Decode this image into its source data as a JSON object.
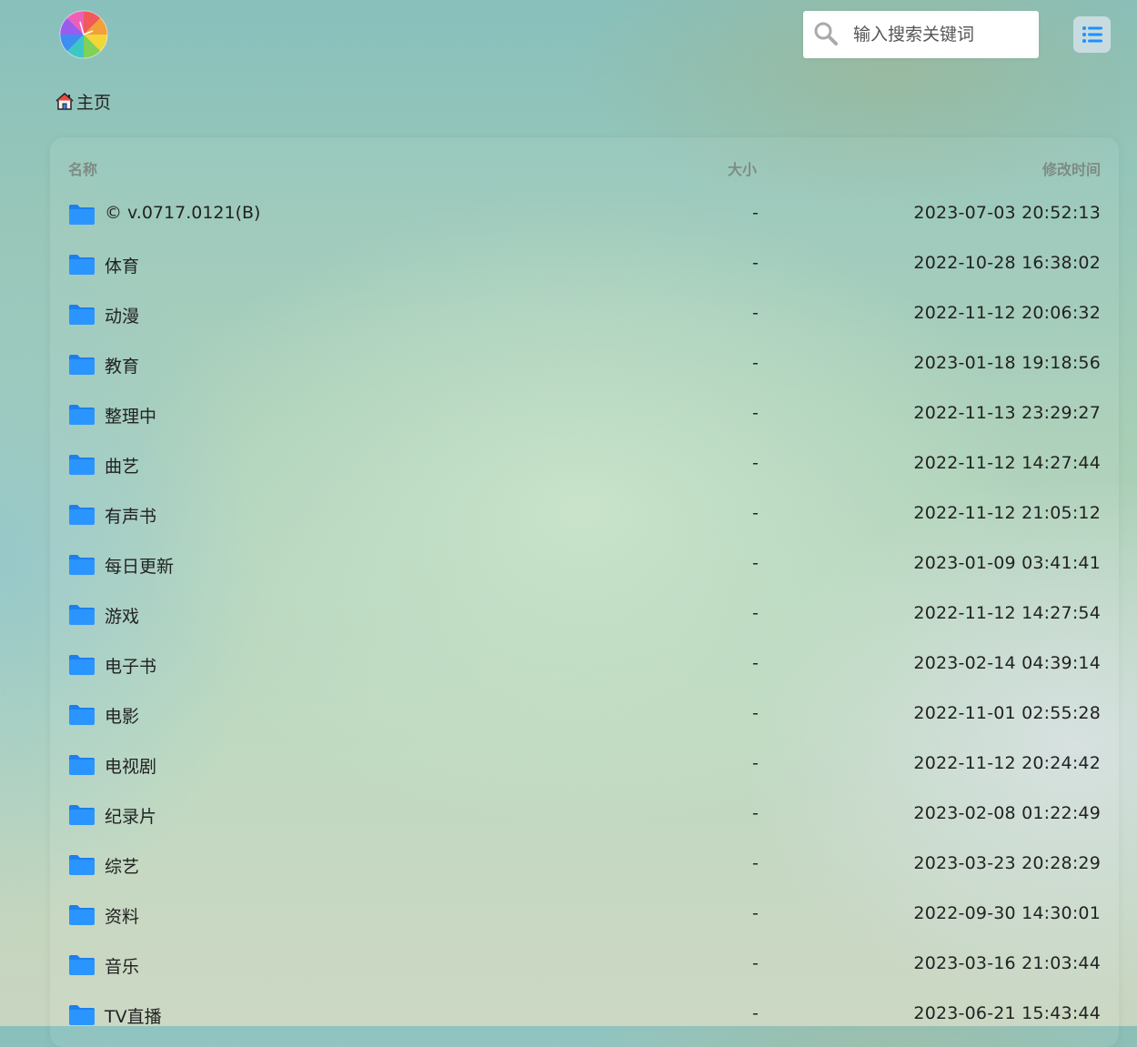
{
  "header": {
    "search": {
      "placeholder": "输入搜索关键词"
    },
    "accent_color": "#1e90ff"
  },
  "breadcrumb": {
    "label": "主页",
    "icon": "home-icon"
  },
  "table": {
    "columns": {
      "name": "名称",
      "size": "大小",
      "modified": "修改时间"
    },
    "rows": [
      {
        "name": "© v.0717.0121(B)",
        "size": "-",
        "modified": "2023-07-03 20:52:13"
      },
      {
        "name": "体育",
        "size": "-",
        "modified": "2022-10-28 16:38:02"
      },
      {
        "name": "动漫",
        "size": "-",
        "modified": "2022-11-12 20:06:32"
      },
      {
        "name": "教育",
        "size": "-",
        "modified": "2023-01-18 19:18:56"
      },
      {
        "name": "整理中",
        "size": "-",
        "modified": "2022-11-13 23:29:27"
      },
      {
        "name": "曲艺",
        "size": "-",
        "modified": "2022-11-12 14:27:44"
      },
      {
        "name": "有声书",
        "size": "-",
        "modified": "2022-11-12 21:05:12"
      },
      {
        "name": "每日更新",
        "size": "-",
        "modified": "2023-01-09 03:41:41"
      },
      {
        "name": "游戏",
        "size": "-",
        "modified": "2022-11-12 14:27:54"
      },
      {
        "name": "电子书",
        "size": "-",
        "modified": "2023-02-14 04:39:14"
      },
      {
        "name": "电影",
        "size": "-",
        "modified": "2022-11-01 02:55:28"
      },
      {
        "name": "电视剧",
        "size": "-",
        "modified": "2022-11-12 20:24:42"
      },
      {
        "name": "纪录片",
        "size": "-",
        "modified": "2023-02-08 01:22:49"
      },
      {
        "name": "综艺",
        "size": "-",
        "modified": "2023-03-23 20:28:29"
      },
      {
        "name": "资料",
        "size": "-",
        "modified": "2022-09-30 14:30:01"
      },
      {
        "name": "音乐",
        "size": "-",
        "modified": "2023-03-16 21:03:44"
      },
      {
        "name": "TV直播",
        "size": "-",
        "modified": "2023-06-21 15:43:44"
      }
    ]
  }
}
